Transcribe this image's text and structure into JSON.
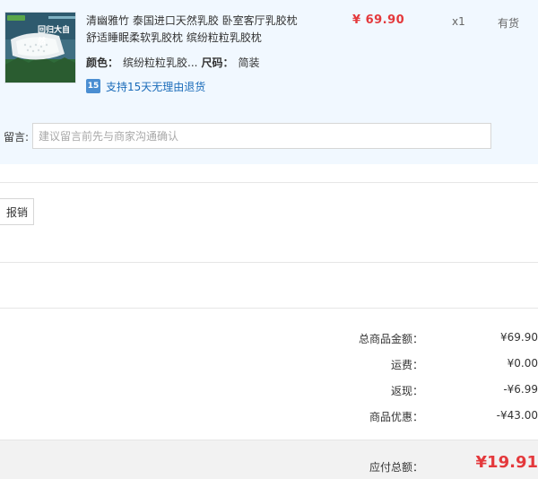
{
  "product": {
    "title_line1": "清幽雅竹 泰国进口天然乳胶 卧室客厅乳胶枕",
    "title_line2": "舒适睡眠柔软乳胶枕 缤纷粒粒乳胶枕",
    "price": "¥ 69.90",
    "quantity": "x1",
    "stock": "有货",
    "color_label": "颜色：",
    "color_value": "缤纷粒粒乳胶...",
    "size_label": "尺码：",
    "size_value": "简装",
    "return_badge": "15",
    "return_text": "支持15天无理由退货",
    "thumbnail_text": "回归大自然"
  },
  "note": {
    "label": "留言:",
    "placeholder": "建议留言前先与商家沟通确认"
  },
  "invoice": {
    "button_label": "报销"
  },
  "summary": {
    "rows": [
      {
        "label": "总商品金额：",
        "value": "¥69.90"
      },
      {
        "label": "运费：",
        "value": "¥0.00"
      },
      {
        "label": "返现：",
        "value": "-¥6.99"
      },
      {
        "label": "商品优惠：",
        "value": "-¥43.00"
      }
    ],
    "total_label": "应付总额：",
    "total_value": "¥19.91"
  }
}
